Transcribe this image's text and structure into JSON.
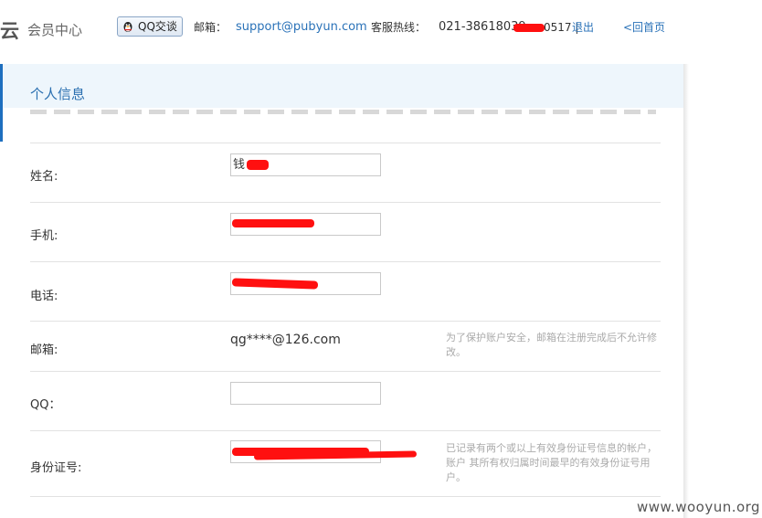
{
  "header": {
    "logo_mark": "云",
    "logo_text": "会员中心",
    "qq_button": "QQ交谈",
    "email_label": "邮箱：",
    "email": "support@pubyun.com",
    "hotline_label": "客服热线：",
    "hotline": "021-38618039",
    "user_suffix": "0517 |",
    "logout": "退出",
    "home": "<回首页"
  },
  "panel": {
    "title": "个人信息"
  },
  "form": {
    "name_label": "姓名:",
    "name_value": "钱",
    "mobile_label": "手机:",
    "phone_label": "电话:",
    "email_label": "邮箱:",
    "email_value": "qg****@126.com",
    "email_hint": "为了保护账户安全，邮箱在注册完成后不允许修改。",
    "qq_label": "QQ：",
    "qq_value": "",
    "id_label": "身份证号:",
    "id_hint": "已记录有两个或以上有效身份证号信息的帐户，账户 其所有权归属时间最早的有效身份证号用户。"
  },
  "watermark": "www.wooyun.org",
  "colors": {
    "link": "#2a72b8",
    "title": "#2a6fb0",
    "header_bg": "#eef6fc",
    "redaction": "#ff1010"
  }
}
